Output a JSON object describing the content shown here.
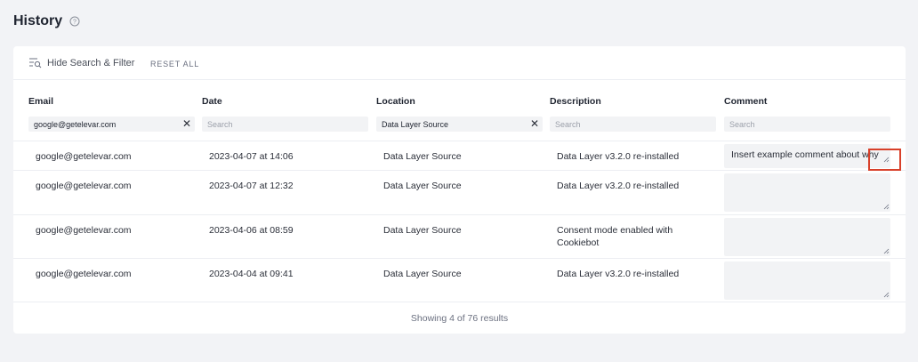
{
  "page": {
    "title": "History",
    "help_icon": "question-circle-icon"
  },
  "toolbar": {
    "toggle_label": "Hide Search & Filter",
    "toggle_icon": "search-filter-icon",
    "reset_label": "RESET ALL"
  },
  "columns": [
    {
      "header": "Email",
      "filter_value": "google@getelevar.com",
      "filter_placeholder": "Search",
      "clearable": true
    },
    {
      "header": "Date",
      "filter_value": "",
      "filter_placeholder": "Search",
      "clearable": false
    },
    {
      "header": "Location",
      "filter_value": "Data Layer Source",
      "filter_placeholder": "Search",
      "clearable": true
    },
    {
      "header": "Description",
      "filter_value": "",
      "filter_placeholder": "Search",
      "clearable": false
    },
    {
      "header": "Comment",
      "filter_value": "",
      "filter_placeholder": "Search",
      "clearable": false
    }
  ],
  "rows": [
    {
      "email": "google@getelevar.com",
      "date": "2023-04-07 at 14:06",
      "location": "Data Layer Source",
      "description": "Data Layer v3.2.0 re-installed",
      "comment": "Insert example comment about why"
    },
    {
      "email": "google@getelevar.com",
      "date": "2023-04-07 at 12:32",
      "location": "Data Layer Source",
      "description": "Data Layer v3.2.0 re-installed",
      "comment": ""
    },
    {
      "email": "google@getelevar.com",
      "date": "2023-04-06 at 08:59",
      "location": "Data Layer Source",
      "description": "Consent mode enabled with Cookiebot",
      "comment": ""
    },
    {
      "email": "google@getelevar.com",
      "date": "2023-04-04 at 09:41",
      "location": "Data Layer Source",
      "description": "Data Layer v3.2.0 re-installed",
      "comment": ""
    }
  ],
  "footer": {
    "results_text": "Showing 4 of 76 results"
  },
  "colors": {
    "background": "#f2f3f6",
    "card": "#ffffff",
    "input": "#f2f3f5",
    "highlight": "#d8402a"
  }
}
